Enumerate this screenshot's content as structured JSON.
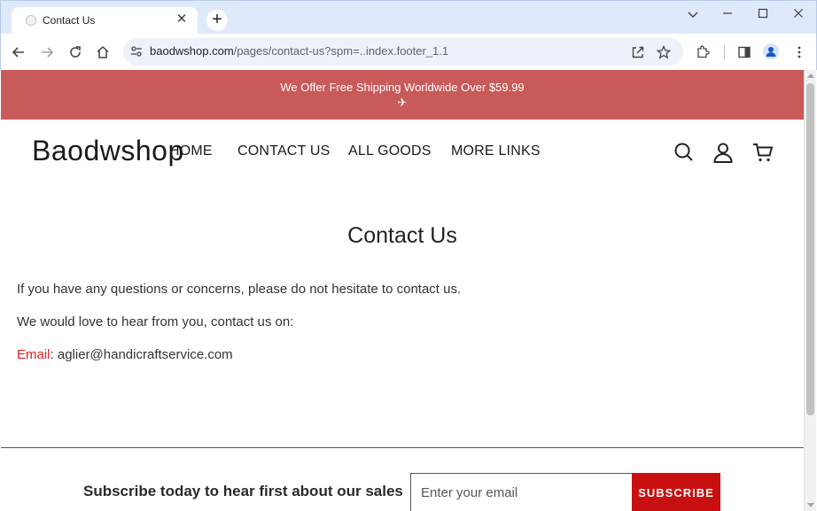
{
  "browser": {
    "tab_title": "Contact Us",
    "tab_close": "✕",
    "new_tab": "+",
    "url_host": "baodwshop.com",
    "url_path": "/pages/contact-us?spm=..index.footer_1.1",
    "window_controls": {
      "collapse": "⌄",
      "minimize": "—",
      "maximize": "☐",
      "close": "✕"
    }
  },
  "announcement": {
    "text": "We Offer Free Shipping Worldwide Over $59.99",
    "icon": "✈"
  },
  "header": {
    "logo": "Baodwshop",
    "nav": [
      {
        "label": "HOME"
      },
      {
        "label": "CONTACT US"
      },
      {
        "label": "ALL GOODS"
      },
      {
        "label": "MORE LINKS"
      }
    ]
  },
  "content": {
    "title": "Contact Us",
    "line1": "If you have any questions or concerns, please do not hesitate to contact us.",
    "line2": "We would love to hear from you, contact us on:",
    "email_label": "Email",
    "email_sep": ": ",
    "email_value": "aglier@handicraftservice.com"
  },
  "footer": {
    "subscribe_text": "Subscribe today to hear first about our sales",
    "email_placeholder": "Enter your email",
    "subscribe_button": "SUBSCRIBE"
  },
  "colors": {
    "announce_bg": "#c85a5a",
    "subscribe_btn": "#c81010",
    "email_label": "#e02020",
    "tabstrip_bg": "#dee9fc"
  }
}
